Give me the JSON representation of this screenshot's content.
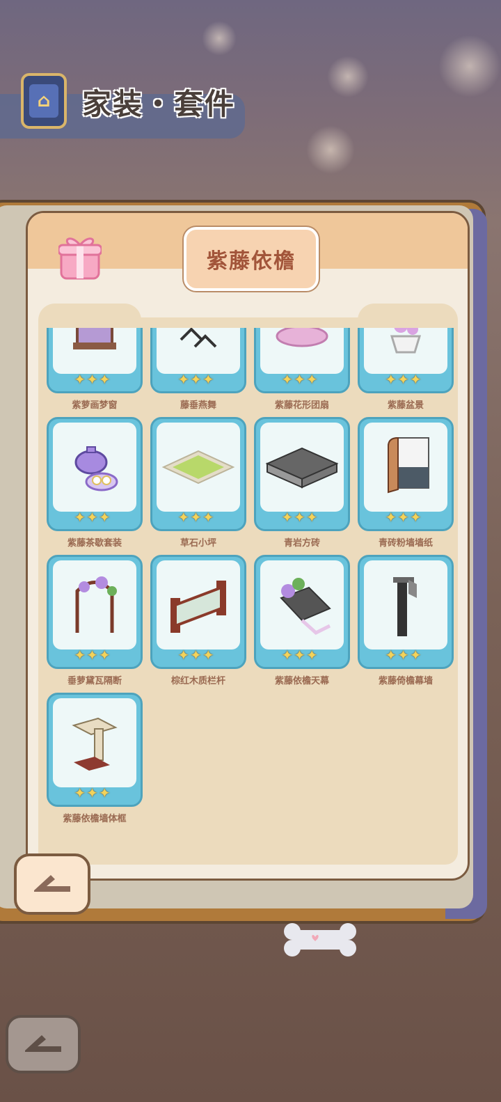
{
  "header": {
    "title": "家装・套件",
    "app_icon": "furniture-chair-icon"
  },
  "set_panel": {
    "title": "紫藤依檐",
    "gift_icon": "gift-box-icon"
  },
  "items": [
    {
      "name": "紫萝画梦窗",
      "stars": "✦✦✦",
      "icon": "wisteria-window-icon"
    },
    {
      "name": "藤垂燕舞",
      "stars": "✦✦✦",
      "icon": "hanging-vines-swallows-icon"
    },
    {
      "name": "紫藤花形团扇",
      "stars": "✦✦✦",
      "icon": "round-fan-icon"
    },
    {
      "name": "紫藤盆景",
      "stars": "✦✦✦",
      "icon": "bonsai-pot-icon"
    },
    {
      "name": "紫藤茶歇套装",
      "stars": "✦✦✦",
      "icon": "teapot-set-icon"
    },
    {
      "name": "草石小坪",
      "stars": "✦✦✦",
      "icon": "grass-stone-lawn-icon"
    },
    {
      "name": "青岩方砖",
      "stars": "✦✦✦",
      "icon": "stone-tile-icon"
    },
    {
      "name": "青砖粉墙墙纸",
      "stars": "✦✦✦",
      "icon": "wallpaper-icon"
    },
    {
      "name": "垂萝黛瓦隔断",
      "stars": "✦✦✦",
      "icon": "tiled-partition-icon"
    },
    {
      "name": "棕红木质栏杆",
      "stars": "✦✦✦",
      "icon": "wooden-railing-icon"
    },
    {
      "name": "紫藤依檐天幕",
      "stars": "✦✦✦",
      "icon": "canopy-icon"
    },
    {
      "name": "紫藤倚檐幕墙",
      "stars": "✦✦✦",
      "icon": "curtain-wall-icon"
    },
    {
      "name": "紫藤依檐墙体框",
      "stars": "✦✦✦",
      "icon": "wall-frame-icon"
    }
  ],
  "buttons": {
    "back_icon": "back-arrow-icon",
    "back2_icon": "back-arrow-icon"
  },
  "colors": {
    "card": "#69c3dc",
    "panel": "#f4ecdf",
    "accent": "#a2553a"
  }
}
